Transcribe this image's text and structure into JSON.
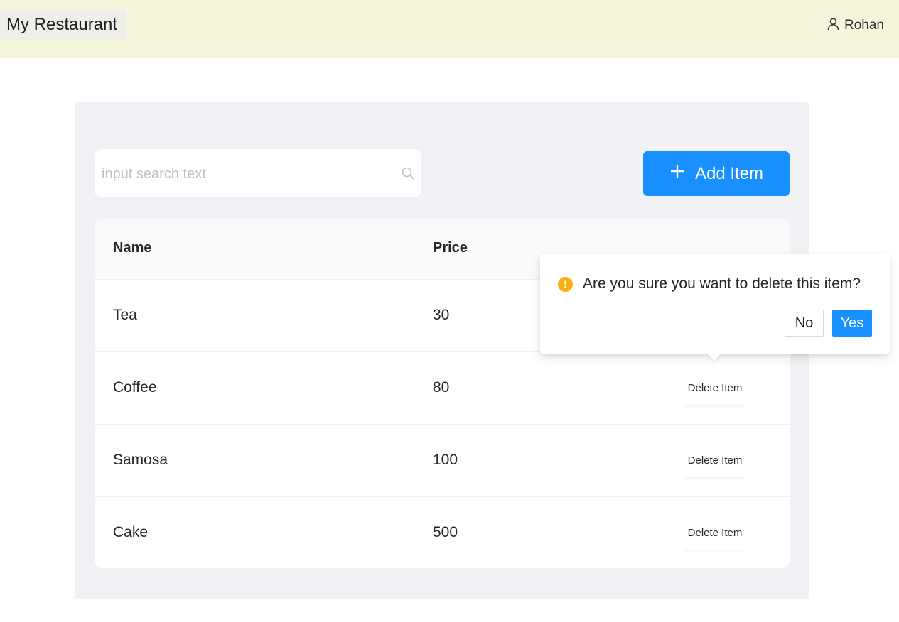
{
  "header": {
    "app_title": "My Restaurant",
    "user_name": "Rohan",
    "user_icon": "user-icon",
    "background": "#f5f5dc"
  },
  "toolbar": {
    "search_placeholder": "input search text",
    "search_value": "",
    "search_icon": "search-icon",
    "add_button_label": "Add Item",
    "add_button_icon": "plus-icon",
    "accent": "#1890ff"
  },
  "table": {
    "columns": [
      "Name",
      "Price"
    ],
    "rows": [
      {
        "name": "Tea",
        "price": "30",
        "action": "Delete Item"
      },
      {
        "name": "Coffee",
        "price": "80",
        "action": "Delete Item"
      },
      {
        "name": "Samosa",
        "price": "100",
        "action": "Delete Item"
      },
      {
        "name": "Cake",
        "price": "500",
        "action": "Delete Item"
      }
    ]
  },
  "popconfirm": {
    "message": "Are you sure you want to delete this item?",
    "icon": "warning-icon",
    "no_label": "No",
    "yes_label": "Yes",
    "warning_color": "#faad14"
  }
}
